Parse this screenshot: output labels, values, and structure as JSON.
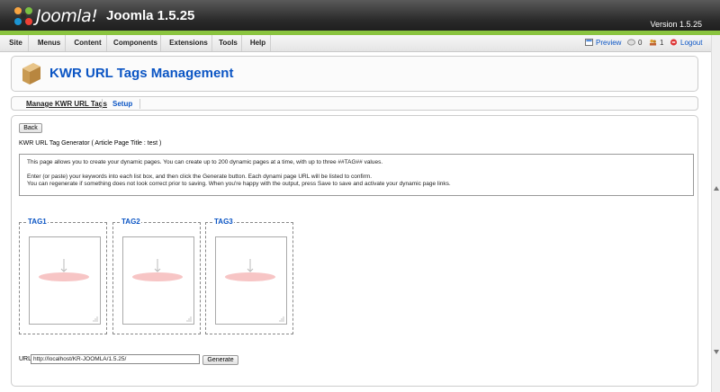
{
  "header": {
    "logo_text": "Joomla!",
    "site_title": "Joomla 1.5.25",
    "version": "Version 1.5.25"
  },
  "menu": {
    "items": [
      "Site",
      "Menus",
      "Content",
      "Components",
      "Extensions",
      "Tools",
      "Help"
    ]
  },
  "status": {
    "preview": "Preview",
    "messages": "0",
    "users": "1",
    "logout": "Logout"
  },
  "page": {
    "title": "KWR URL Tags Management"
  },
  "submenu": {
    "items": [
      "Manage KWR URL Tags",
      "Setup"
    ]
  },
  "main": {
    "back_label": "Back",
    "generator_title": "KWR URL Tag Generator ( Article Page Title : test )",
    "info": [
      "This page allows you to create your dynamic pages. You can create up to 200 dynamic pages at a time, with up to three ##TAG## values.",
      "Enter (or paste) your keywords into each list box, and then click the Generate button. Each dynami page URL will be listed to confirm.",
      "You can regenerate if something does not look correct prior to saving. When you're happy with the output, press Save to save and activate your dynamic page links."
    ],
    "tags": [
      {
        "label": "TAG1"
      },
      {
        "label": "TAG2"
      },
      {
        "label": "TAG3"
      }
    ],
    "url_label": "URL",
    "url_value": "http://localhost/KR-JOOMLA/1.5.25/",
    "generate_label": "Generate"
  },
  "colors": {
    "accent_green": "#8ac43f",
    "link_blue": "#0b55c4",
    "plugin_placeholder": "#f7c5c5"
  }
}
